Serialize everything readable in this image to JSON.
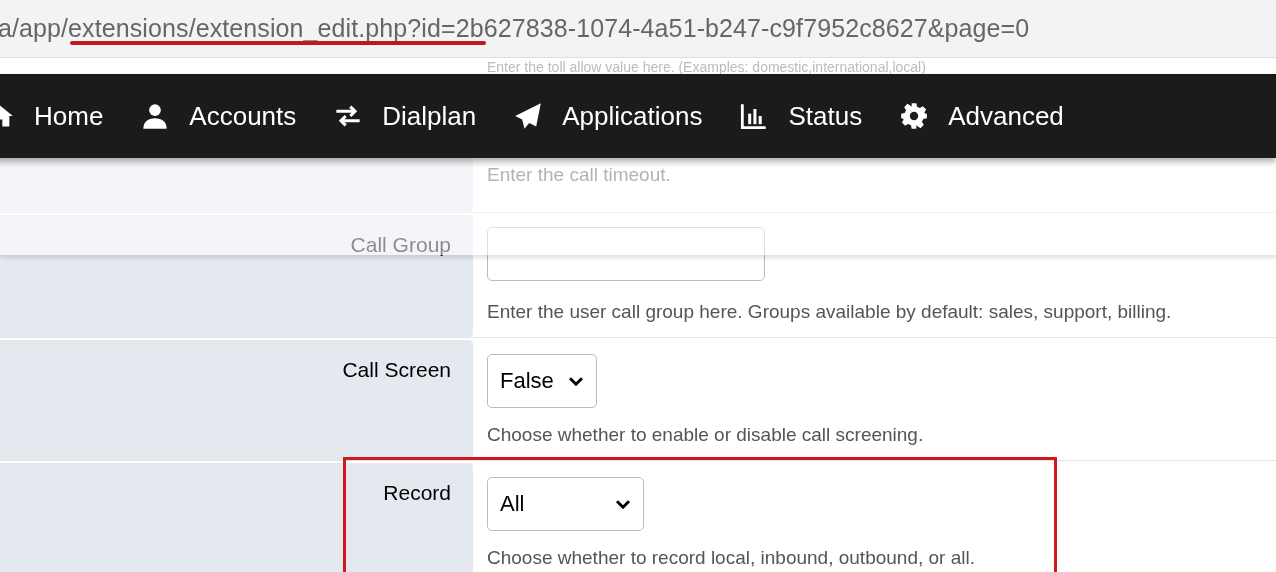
{
  "browser": {
    "url": "a/app/extensions/extension_edit.php?id=2b627838-1074-4a51-b247-c9f7952c8627&page=0",
    "underlined": true
  },
  "behind_nav_text": "Enter the toll allow value here. (Examples: domestic,international,local)",
  "nav": [
    {
      "label": "Home"
    },
    {
      "label": "Accounts"
    },
    {
      "label": "Dialplan"
    },
    {
      "label": "Applications"
    },
    {
      "label": "Status"
    },
    {
      "label": "Advanced"
    }
  ],
  "rows": [
    {
      "kind": "help",
      "help": "Enter the call timeout."
    },
    {
      "kind": "input",
      "label": "Call Group",
      "help": "Enter the user call group here. Groups available by default: sales, support, billing."
    },
    {
      "kind": "select",
      "label": "Call Screen",
      "value": "False",
      "help": "Choose whether to enable or disable call screening."
    },
    {
      "kind": "select",
      "label": "Record",
      "value": "All",
      "help": "Choose whether to record local, inbound, outbound, or all.",
      "highlighted": true
    }
  ]
}
